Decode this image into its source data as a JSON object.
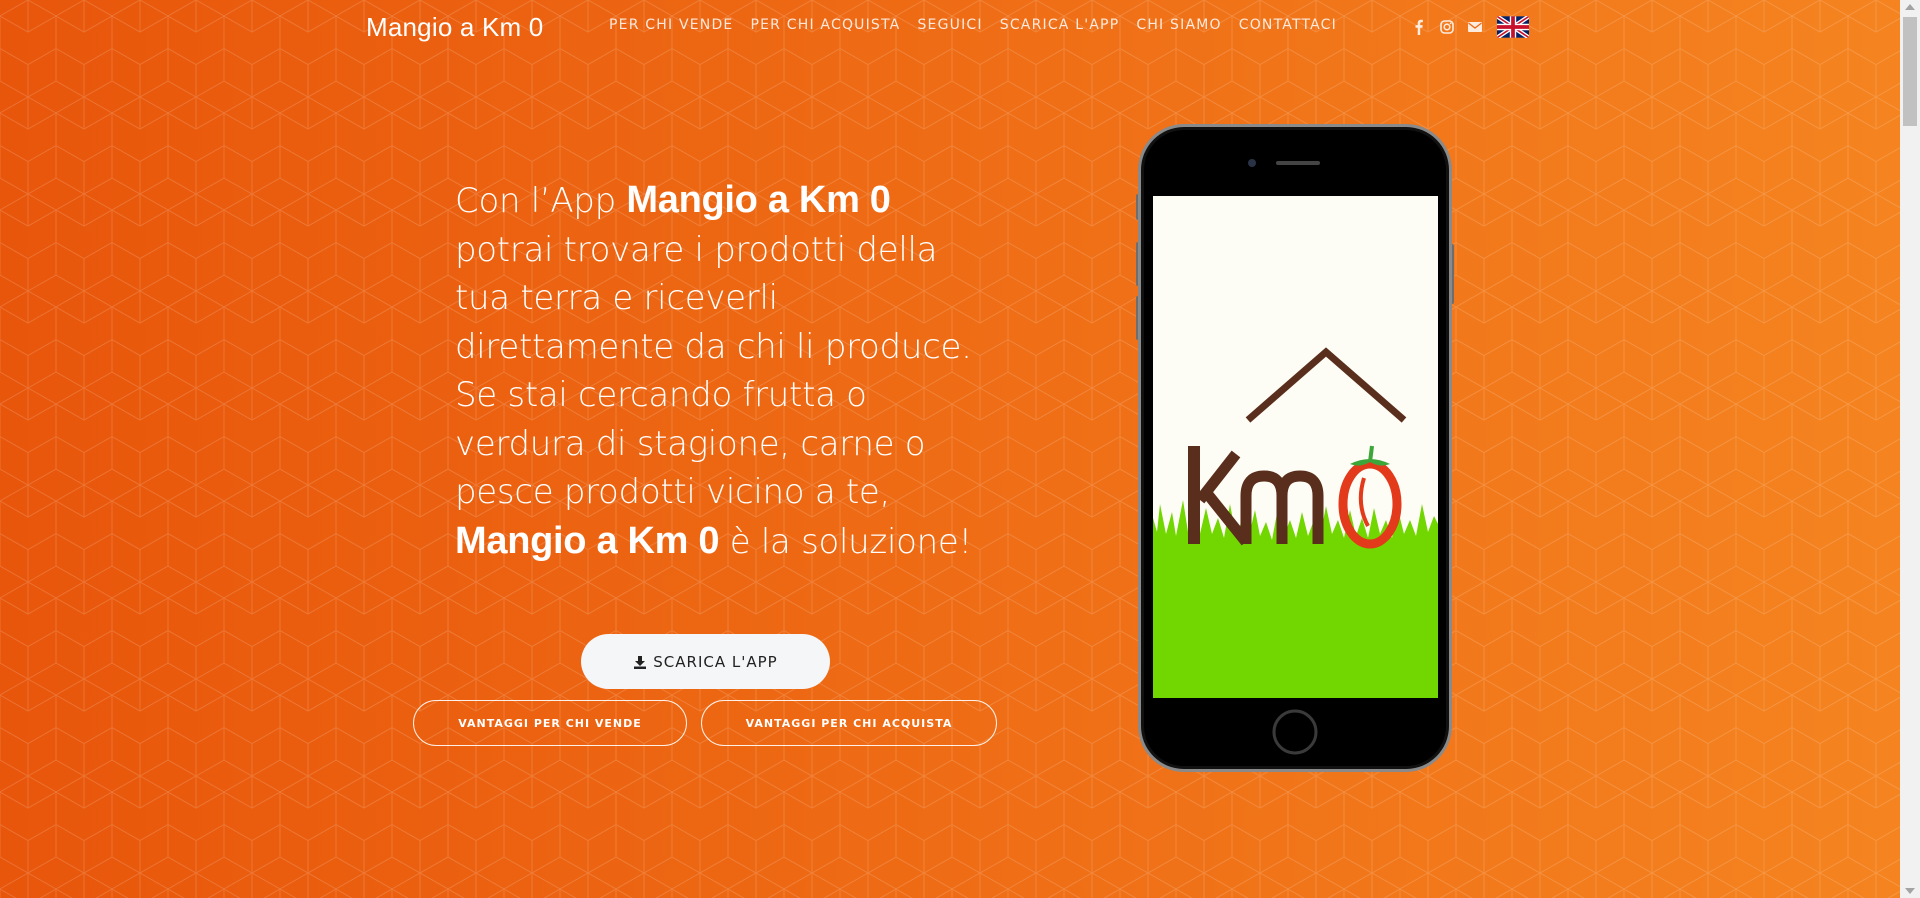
{
  "navbar": {
    "brand": "Mangio a Km 0",
    "links": [
      {
        "label": "PER CHI VENDE"
      },
      {
        "label": "PER CHI ACQUISTA"
      },
      {
        "label": "SEGUICI"
      },
      {
        "label": "SCARICA L'APP"
      },
      {
        "label": "CHI SIAMO"
      },
      {
        "label": "CONTATTACI"
      }
    ],
    "icons": [
      "facebook-icon",
      "instagram-icon",
      "envelope-icon",
      "uk-flag-icon"
    ]
  },
  "hero": {
    "intro": "Con l’App ",
    "brand_1": "Mangio a Km 0",
    "middle": " potrai trovare i prodotti della tua terra e riceverli direttamente da chi li produce. Se stai cercando frutta o verdura di stagione, carne o pesce prodotti vicino a te, ",
    "brand_2": "Mangio a Km 0",
    "outro": " è la soluzione!"
  },
  "buttons": {
    "download": "SCARICA L'APP",
    "sellers": "VANTAGGI PER CHI VENDE",
    "buyers": "VANTAGGI PER CHI ACQUISTA"
  },
  "phone": {
    "logo_text": "Km0"
  },
  "colors": {
    "background_start": "#e8560b",
    "background_end": "#f58420",
    "grass": "#72d600",
    "logo_brown": "#5a2e1c",
    "logo_red": "#e23a1b"
  }
}
